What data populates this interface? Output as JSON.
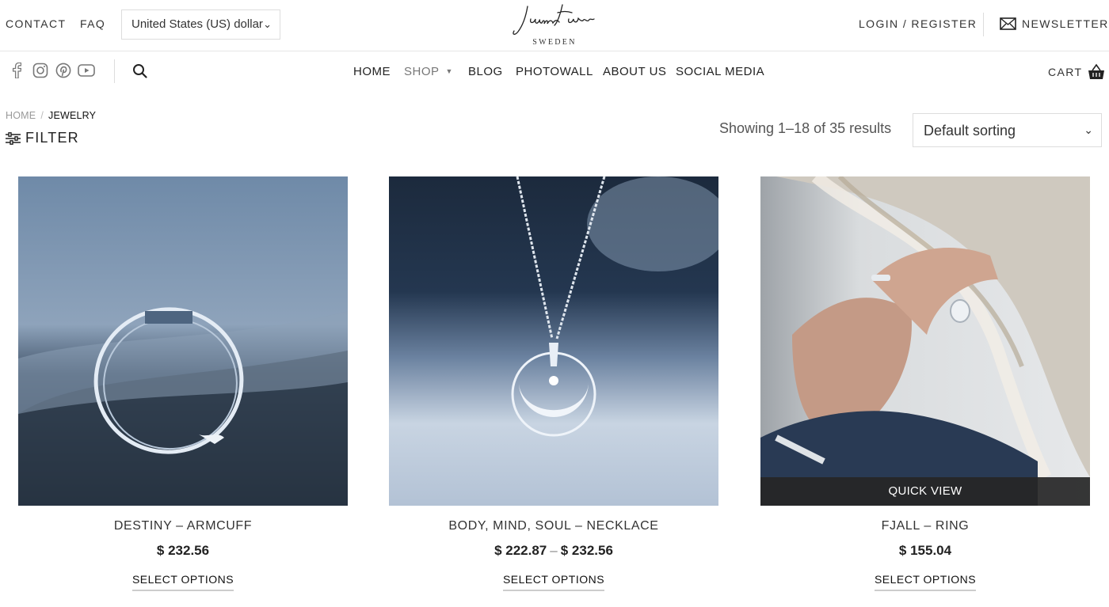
{
  "topbar": {
    "contact": "CONTACT",
    "faq": "FAQ",
    "currency": "United States (US) dollar",
    "login": "LOGIN / REGISTER",
    "newsletter": "NEWSLETTER",
    "logo_sub": "SWEDEN"
  },
  "social_icons": [
    "facebook-icon",
    "instagram-icon",
    "pinterest-icon",
    "youtube-icon"
  ],
  "nav": {
    "home": "HOME",
    "shop": "SHOP",
    "blog": "BLOG",
    "photowall": "PHOTOWALL",
    "about": "ABOUT US",
    "social": "SOCIAL MEDIA",
    "cart": "CART"
  },
  "breadcrumb": {
    "home": "HOME",
    "current": "JEWELRY"
  },
  "toolbar": {
    "filter": "FILTER",
    "results": "Showing 1–18 of 35 results",
    "sorting": "Default sorting"
  },
  "products": [
    {
      "name": "DESTINY – ARMCUFF",
      "price": "$ 232.56",
      "button": "SELECT OPTIONS"
    },
    {
      "name": "BODY, MIND, SOUL – NECKLACE",
      "price_low": "$ 222.87",
      "price_high": "$ 232.56",
      "button": "SELECT OPTIONS"
    },
    {
      "name": "FJALL – RING",
      "price": "$ 155.04",
      "button": "SELECT OPTIONS",
      "quick_view": "QUICK VIEW"
    }
  ],
  "colors": {
    "quick_view_bg": "#262626",
    "text": "#222222",
    "muted": "#777777"
  }
}
